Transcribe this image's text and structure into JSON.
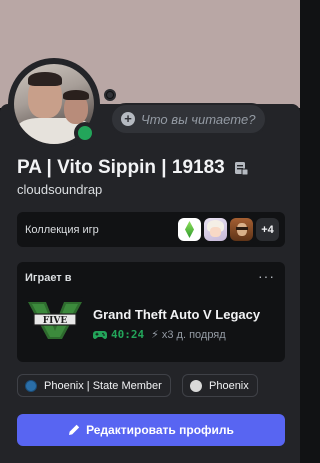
{
  "profile": {
    "display_name": "PA | Vito Sippin | 19183",
    "username": "cloudsoundrap",
    "status": "online"
  },
  "custom_status": {
    "placeholder": "Что вы читаете?",
    "icon": "plus-circle-icon"
  },
  "collection": {
    "label": "Коллекция игр",
    "games": [
      "sims-plumbob-icon",
      "anime-character-icon",
      "man-portrait-icon"
    ],
    "more": "+4"
  },
  "activity": {
    "label": "Играет в",
    "menu": "···",
    "game_title": "Grand Theft Auto V Legacy",
    "elapsed": "40:24",
    "streak": "x3 д. подряд",
    "icon": "gta-v-logo-icon"
  },
  "servers": [
    {
      "name": "Phoenix | State Member",
      "color": "#2a6ea8"
    },
    {
      "name": "Phoenix",
      "color": "#d9d9d9"
    }
  ],
  "edit_button": {
    "label": "Редактировать профиль",
    "icon": "pencil-icon"
  },
  "colors": {
    "accent": "#5865f2",
    "online": "#23a55a",
    "banner": "#b9a7a5"
  }
}
